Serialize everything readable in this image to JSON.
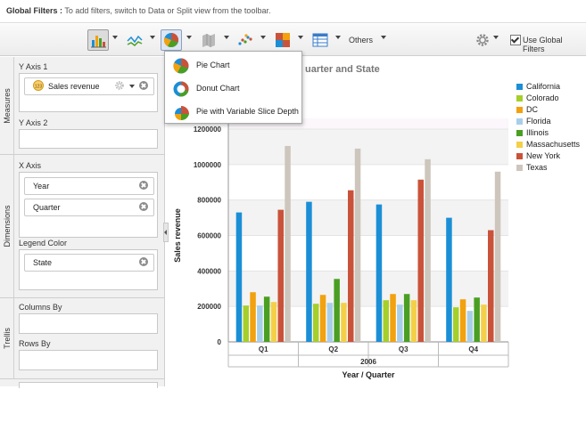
{
  "global_filters": {
    "label": "Global Filters :",
    "hint": "To add filters, switch to Data or Split view from the toolbar."
  },
  "toolbar": {
    "others_label": "Others",
    "use_global_filters_label": "Use Global Filters",
    "use_global_filters_checked": true,
    "icons": [
      "bar-chart-icon",
      "line-chart-icon",
      "pie-chart-icon",
      "map-icon",
      "scatter-chart-icon",
      "heatmap-icon",
      "table-icon",
      "gear-icon"
    ]
  },
  "chart_type_menu": {
    "items": [
      {
        "label": "Pie Chart",
        "icon": "pie-chart-icon"
      },
      {
        "label": "Donut Chart",
        "icon": "donut-chart-icon"
      },
      {
        "label": "Pie with Variable Slice Depth",
        "icon": "variable-pie-icon"
      }
    ]
  },
  "left_panel": {
    "measures": {
      "section_label": "Measures",
      "y_axis_1_label": "Y Axis 1",
      "y_axis_1_item": "Sales revenue",
      "y_axis_2_label": "Y Axis 2"
    },
    "dimensions": {
      "section_label": "Dimensions",
      "x_axis_label": "X Axis",
      "x_axis_items": [
        "Year",
        "Quarter"
      ],
      "legend_color_label": "Legend Color",
      "legend_color_items": [
        "State"
      ]
    },
    "trellis": {
      "section_label": "Trellis",
      "columns_by_label": "Columns By",
      "rows_by_label": "Rows By"
    }
  },
  "chart_data": {
    "type": "bar",
    "title": "uarter and State",
    "xlabel": "Year / Quarter",
    "ylabel": "Sales revenue",
    "ylim": [
      0,
      1200000
    ],
    "y_ticks": [
      0,
      200000,
      400000,
      600000,
      800000,
      1000000,
      1200000
    ],
    "y_tick_labels": [
      "0",
      "200000",
      "400000",
      "600000",
      "800000",
      "1000000",
      "1200000"
    ],
    "year_label": "2006",
    "categories": [
      "Q1",
      "Q2",
      "Q3",
      "Q4"
    ],
    "series": [
      {
        "name": "California",
        "color": "#1b8fd6",
        "values": [
          730000,
          790000,
          775000,
          700000
        ]
      },
      {
        "name": "Colorado",
        "color": "#a5cf2a",
        "values": [
          205000,
          215000,
          235000,
          195000
        ]
      },
      {
        "name": "DC",
        "color": "#f2a10f",
        "values": [
          280000,
          265000,
          270000,
          240000
        ]
      },
      {
        "name": "Florida",
        "color": "#a8cfea",
        "values": [
          205000,
          220000,
          210000,
          175000
        ]
      },
      {
        "name": "Illinois",
        "color": "#4a9f22",
        "values": [
          255000,
          355000,
          270000,
          250000
        ]
      },
      {
        "name": "Massachusetts",
        "color": "#f3d048",
        "values": [
          225000,
          220000,
          235000,
          210000
        ]
      },
      {
        "name": "New York",
        "color": "#c9533a",
        "values": [
          745000,
          855000,
          915000,
          630000
        ]
      },
      {
        "name": "Texas",
        "color": "#cdc6bc",
        "values": [
          1105000,
          1090000,
          1030000,
          960000
        ]
      }
    ]
  }
}
